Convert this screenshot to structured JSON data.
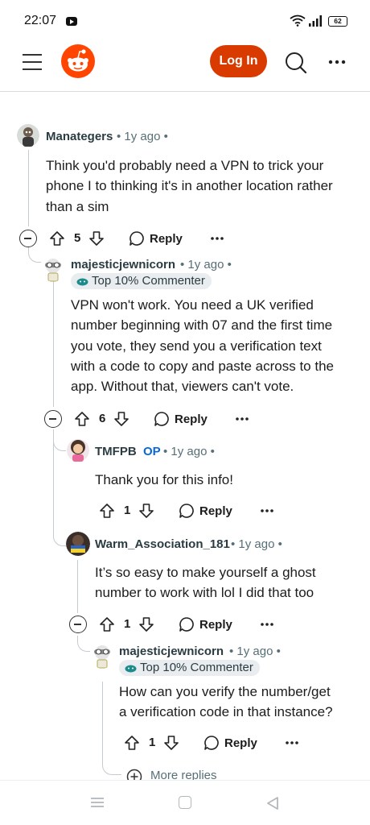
{
  "status_bar": {
    "time": "22:07",
    "battery": "62"
  },
  "header": {
    "login_label": "Log In",
    "icons": [
      "menu-icon",
      "reddit-logo-icon",
      "search-icon",
      "more-icon"
    ]
  },
  "comments": [
    {
      "username": "Manategers",
      "meta": "• 1y ago •",
      "text_lines": [
        "Think you'd probably need a VPN to trick your",
        "phone I to thinking it's in another location rather",
        "than a sim"
      ],
      "votes": "5",
      "reply_label": "Reply"
    },
    {
      "username": "majesticjewnicorn",
      "meta": "• 1y ago •",
      "flair": "Top 10% Commenter",
      "text_lines": [
        "VPN won't work. You need a UK verified",
        "number beginning with 07 and the first time",
        "you vote, they send you a verification text",
        "with a code to copy and paste across to the",
        "app. Without that, viewers can't vote."
      ],
      "votes": "6",
      "reply_label": "Reply"
    },
    {
      "username": "TMFPB",
      "op_label": "OP",
      "meta": "• 1y ago •",
      "text_lines": [
        "Thank you for this info!"
      ],
      "votes": "1",
      "reply_label": "Reply"
    },
    {
      "username": "Warm_Association_181",
      "meta": "• 1y ago •",
      "text_lines": [
        "It’s so easy to make yourself a ghost",
        "number to work with lol I did that too"
      ],
      "votes": "1",
      "reply_label": "Reply"
    },
    {
      "username": "majesticjewnicorn",
      "meta": "• 1y ago •",
      "flair": "Top 10% Commenter",
      "text_lines": [
        "How can you verify the number/get",
        "a verification code in that instance?"
      ],
      "votes": "1",
      "reply_label": "Reply"
    }
  ],
  "more_replies_label": "More replies",
  "colors": {
    "login_button": "#d93a00",
    "op_badge": "#0a66d6",
    "meta_text": "#576f76",
    "thread_line": "#c5ccd0"
  }
}
